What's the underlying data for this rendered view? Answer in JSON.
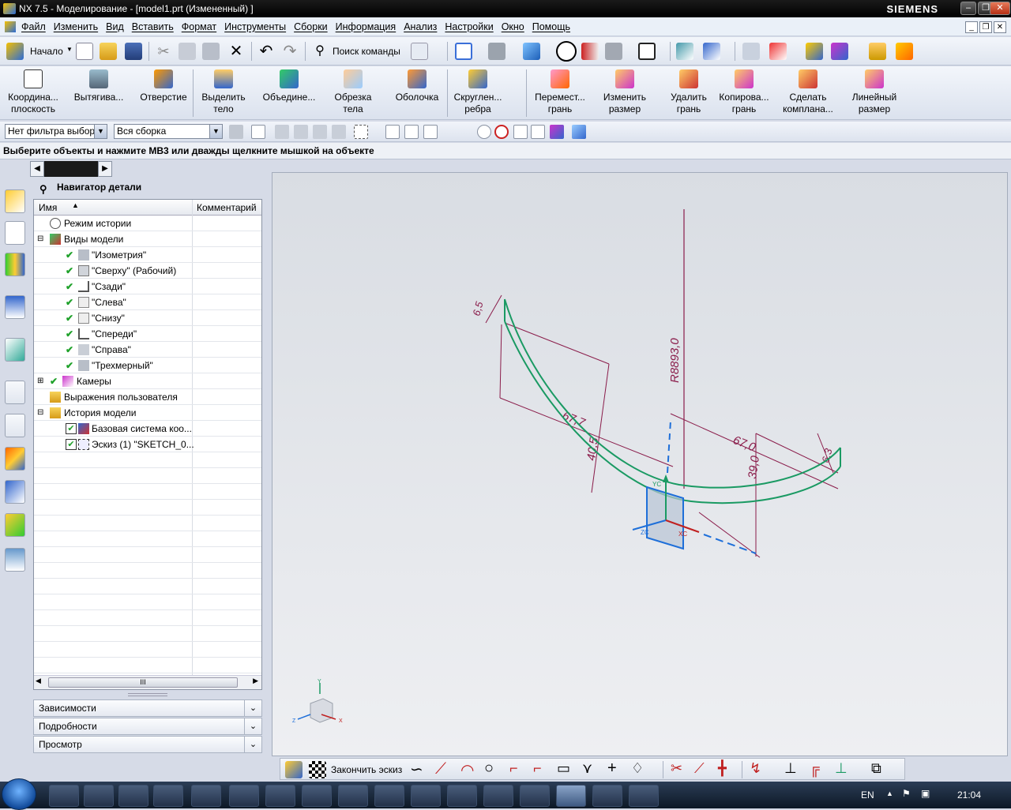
{
  "window": {
    "title": "NX 7.5 - Моделирование - [model1.prt (Измененный) ]",
    "brand": "SIEMENS"
  },
  "menu": [
    "Файл",
    "Изменить",
    "Вид",
    "Вставить",
    "Формат",
    "Инструменты",
    "Сборки",
    "Информация",
    "Анализ",
    "Настройки",
    "Окно",
    "Помощь"
  ],
  "toolbar1": {
    "start_label": "Начало",
    "command_search": "Поиск команды"
  },
  "toolbar2": [
    {
      "l1": "Координа...",
      "l2": "плоскость"
    },
    {
      "l1": "Вытягива...",
      "l2": ""
    },
    {
      "l1": "Отверстие",
      "l2": ""
    },
    {
      "l1": "Выделить",
      "l2": "тело"
    },
    {
      "l1": "Объедине...",
      "l2": ""
    },
    {
      "l1": "Обрезка",
      "l2": "тела"
    },
    {
      "l1": "Оболочка",
      "l2": ""
    },
    {
      "l1": "Скруглен...",
      "l2": "ребра"
    },
    {
      "l1": "Перемест...",
      "l2": "грань"
    },
    {
      "l1": "Изменить",
      "l2": "размер"
    },
    {
      "l1": "Удалить",
      "l2": "грань"
    },
    {
      "l1": "Копирова...",
      "l2": "грань"
    },
    {
      "l1": "Сделать",
      "l2": "компланa..."
    },
    {
      "l1": "Линейный",
      "l2": "размер"
    }
  ],
  "filter": {
    "type_filter": "Нет фильтра выбор",
    "scope": "Вся сборка"
  },
  "cue_line": "Выберите объекты и нажмите MB3 или дважды щелкните мышкой на объекте",
  "navigator": {
    "title": "Навигатор детали",
    "col_name": "Имя",
    "col_comment": "Комментарий",
    "rows": [
      {
        "label": "Режим истории"
      },
      {
        "label": "Виды модели"
      },
      {
        "label": "\"Изометрия\""
      },
      {
        "label": "\"Сверху\" (Рабочий)"
      },
      {
        "label": "\"Сзади\""
      },
      {
        "label": "\"Слева\""
      },
      {
        "label": "\"Снизу\""
      },
      {
        "label": "\"Спереди\""
      },
      {
        "label": "\"Справа\""
      },
      {
        "label": "\"Трехмерный\""
      },
      {
        "label": "Камеры"
      },
      {
        "label": "Выражения пользователя"
      },
      {
        "label": "История модели"
      },
      {
        "label": "Базовая система коо..."
      },
      {
        "label": "Эскиз (1) \"SKETCH_0..."
      }
    ],
    "scroll_mark": "III",
    "panels": [
      "Зависимости",
      "Подробности",
      "Просмотр"
    ]
  },
  "sketch": {
    "dims": [
      "6,5",
      "67,7",
      "40,5",
      "67,0",
      "39,0",
      "6,3",
      "R8893,0"
    ],
    "axes": [
      "YC",
      "XC",
      "ZC",
      "Y",
      "X",
      "Z"
    ]
  },
  "sketch_toolbar": {
    "finish_label": "Закончить эскиз"
  },
  "taskbar": {
    "lang": "EN",
    "time": "21:04"
  },
  "colors": {
    "sketch_curve": "#1a9a63",
    "dimension": "#8a1c4a",
    "selection_blue": "#1e6fd9"
  }
}
